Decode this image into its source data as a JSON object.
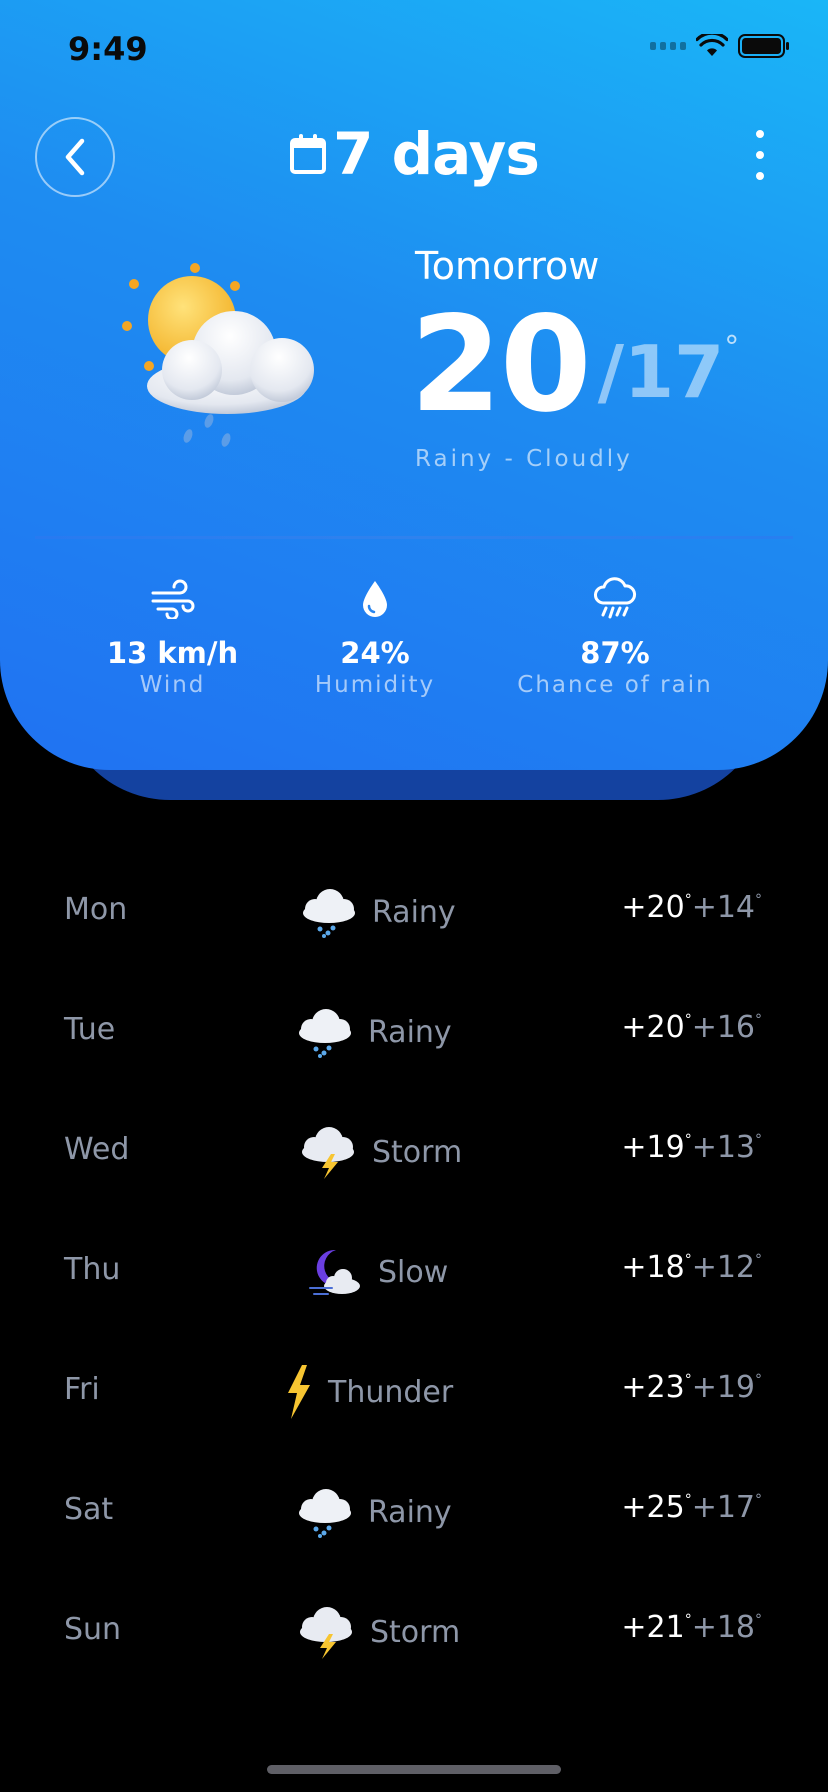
{
  "status_bar": {
    "time": "9:49"
  },
  "header": {
    "title": "7 days"
  },
  "hero": {
    "day_label": "Tomorrow",
    "temp_high": "20",
    "temp_low": "/17",
    "degree": "°",
    "condition": "Rainy - Cloudly"
  },
  "stats": {
    "wind": {
      "value": "13 km/h",
      "label": "Wind"
    },
    "humidity": {
      "value": "24%",
      "label": "Humidity"
    },
    "rain": {
      "value": "87%",
      "label": "Chance of rain"
    }
  },
  "days": [
    {
      "day": "Mon",
      "icon": "rain-cloud-icon",
      "condition": "Rainy",
      "high": "+20",
      "low": "+14"
    },
    {
      "day": "Tue",
      "icon": "rain-cloud-icon",
      "condition": "Rainy",
      "high": "+20",
      "low": "+16"
    },
    {
      "day": "Wed",
      "icon": "storm-cloud-icon",
      "condition": "Storm",
      "high": "+19",
      "low": "+13"
    },
    {
      "day": "Thu",
      "icon": "moon-cloud-icon",
      "condition": "Slow",
      "high": "+18",
      "low": "+12"
    },
    {
      "day": "Fri",
      "icon": "lightning-icon",
      "condition": "Thunder",
      "high": "+23",
      "low": "+19"
    },
    {
      "day": "Sat",
      "icon": "rain-cloud-icon",
      "condition": "Rainy",
      "high": "+25",
      "low": "+17"
    },
    {
      "day": "Sun",
      "icon": "storm-cloud-icon",
      "condition": "Storm",
      "high": "+21",
      "low": "+18"
    }
  ],
  "degree_symbol": "°",
  "colors": {
    "card_top": "#1ab6f7",
    "card_bottom": "#2072f2",
    "muted_text": "#8e97a8",
    "background": "#000000"
  }
}
